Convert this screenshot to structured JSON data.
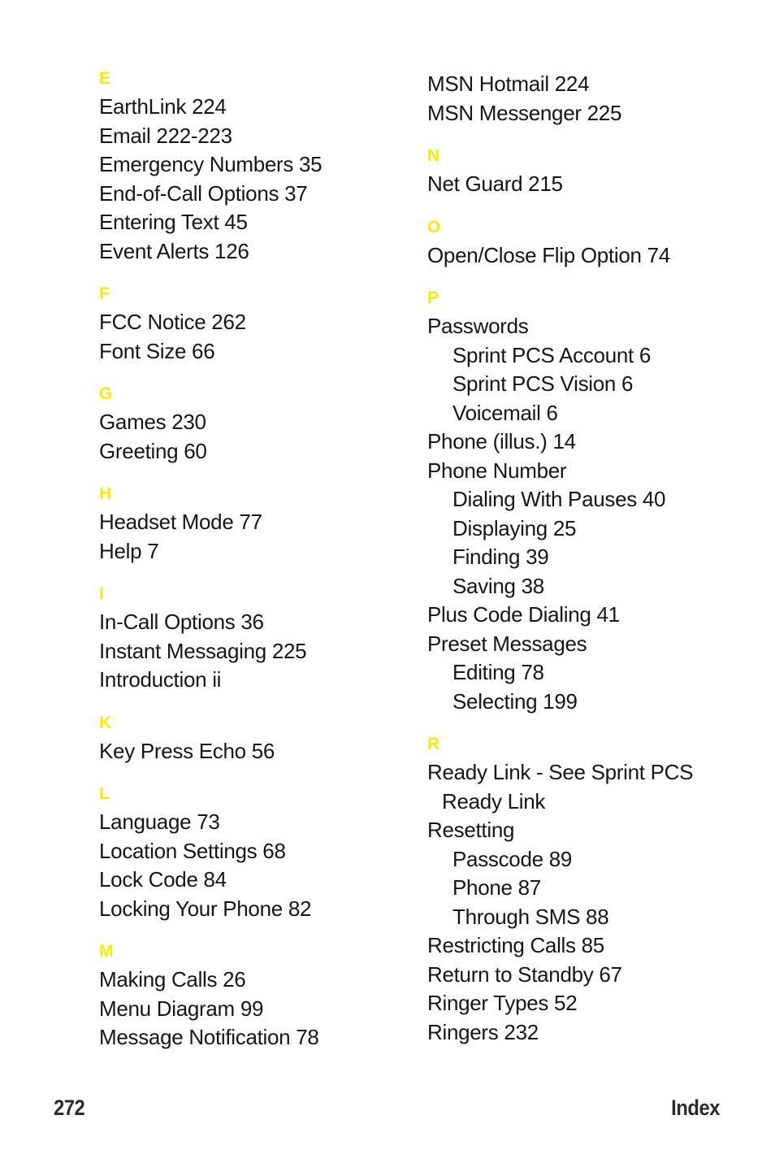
{
  "page": {
    "number": "272",
    "running_head": "Index",
    "heading_color": "#FFE800",
    "text_color": "#161616"
  },
  "columns": [
    {
      "name": "left",
      "sections": [
        {
          "letter": "E",
          "entries": [
            {
              "text": "EarthLink 224",
              "level": 0
            },
            {
              "text": "Email 222-223",
              "level": 0
            },
            {
              "text": "Emergency Numbers 35",
              "level": 0
            },
            {
              "text": "End-of-Call Options 37",
              "level": 0
            },
            {
              "text": "Entering Text 45",
              "level": 0
            },
            {
              "text": "Event Alerts 126",
              "level": 0
            }
          ]
        },
        {
          "letter": "F",
          "entries": [
            {
              "text": "FCC Notice 262",
              "level": 0
            },
            {
              "text": "Font Size 66",
              "level": 0
            }
          ]
        },
        {
          "letter": "G",
          "entries": [
            {
              "text": "Games 230",
              "level": 0
            },
            {
              "text": "Greeting 60",
              "level": 0
            }
          ]
        },
        {
          "letter": "H",
          "entries": [
            {
              "text": "Headset Mode 77",
              "level": 0
            },
            {
              "text": "Help 7",
              "level": 0
            }
          ]
        },
        {
          "letter": "I",
          "entries": [
            {
              "text": "In-Call Options 36",
              "level": 0
            },
            {
              "text": "Instant Messaging 225",
              "level": 0
            },
            {
              "text": "Introduction ii",
              "level": 0
            }
          ]
        },
        {
          "letter": "K",
          "entries": [
            {
              "text": "Key Press Echo 56",
              "level": 0
            }
          ]
        },
        {
          "letter": "L",
          "entries": [
            {
              "text": "Language 73",
              "level": 0
            },
            {
              "text": "Location Settings 68",
              "level": 0
            },
            {
              "text": "Lock Code 84",
              "level": 0
            },
            {
              "text": "Locking Your Phone 82",
              "level": 0
            }
          ]
        },
        {
          "letter": "M",
          "entries": [
            {
              "text": "Making Calls 26",
              "level": 0
            },
            {
              "text": "Menu Diagram 99",
              "level": 0
            },
            {
              "text": "Message Notification 78",
              "level": 0
            }
          ]
        }
      ]
    },
    {
      "name": "right",
      "sections": [
        {
          "letter": "",
          "entries": [
            {
              "text": "MSN Hotmail 224",
              "level": 0
            },
            {
              "text": "MSN Messenger 225",
              "level": 0
            }
          ]
        },
        {
          "letter": "N",
          "entries": [
            {
              "text": "Net Guard 215",
              "level": 0
            }
          ]
        },
        {
          "letter": "O",
          "entries": [
            {
              "text": "Open/Close Flip Option 74",
              "level": 0
            }
          ]
        },
        {
          "letter": "P",
          "entries": [
            {
              "text": "Passwords",
              "level": 0
            },
            {
              "text": "Sprint PCS Account 6",
              "level": 1
            },
            {
              "text": "Sprint PCS Vision 6",
              "level": 1
            },
            {
              "text": "Voicemail 6",
              "level": 1
            },
            {
              "text": "Phone (illus.) 14",
              "level": 0
            },
            {
              "text": "Phone Number",
              "level": 0
            },
            {
              "text": "Dialing With Pauses 40",
              "level": 1
            },
            {
              "text": "Displaying 25",
              "level": 1
            },
            {
              "text": "Finding 39",
              "level": 1
            },
            {
              "text": "Saving 38",
              "level": 1
            },
            {
              "text": "Plus Code Dialing 41",
              "level": 0
            },
            {
              "text": "Preset Messages",
              "level": 0
            },
            {
              "text": "Editing 78",
              "level": 1
            },
            {
              "text": "Selecting 199",
              "level": 1
            }
          ]
        },
        {
          "letter": "R",
          "entries": [
            {
              "text": "Ready Link - See Sprint PCS",
              "level": 0
            },
            {
              "text": "Ready Link",
              "level": 2
            },
            {
              "text": "Resetting",
              "level": 0
            },
            {
              "text": "Passcode 89",
              "level": 1
            },
            {
              "text": "Phone 87",
              "level": 1
            },
            {
              "text": "Through SMS 88",
              "level": 1
            },
            {
              "text": "Restricting Calls 85",
              "level": 0
            },
            {
              "text": "Return to Standby 67",
              "level": 0
            },
            {
              "text": "Ringer Types 52",
              "level": 0
            },
            {
              "text": "Ringers 232",
              "level": 0
            }
          ]
        }
      ]
    }
  ]
}
